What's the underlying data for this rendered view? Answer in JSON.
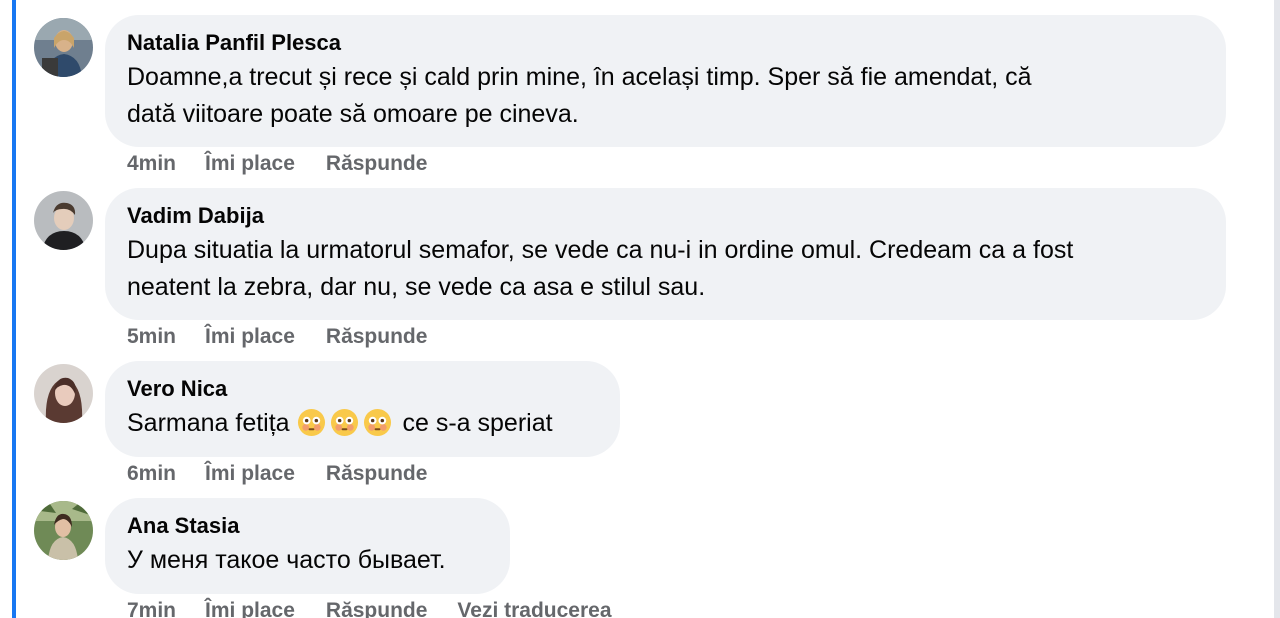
{
  "comments": [
    {
      "author": "Natalia Panfil Plesca",
      "text_lines": [
        "Doamne,a trecut și rece și cald prin mine, în același timp. Sper să fie amendat, că",
        "dată viitoare poate să omoare pe cineva."
      ],
      "time": "4min",
      "like_label": "Îmi place",
      "reply_label": "Răspunde"
    },
    {
      "author": "Vadim Dabija",
      "text_lines": [
        "Dupa situatia la urmatorul semafor, se vede ca nu-i in ordine omul. Credeam ca a fost",
        "neatent la zebra, dar nu, se vede ca asa e stilul sau."
      ],
      "time": "5min",
      "like_label": "Îmi place",
      "reply_label": "Răspunde"
    },
    {
      "author": "Vero Nica",
      "text_before_emoji": "Sarmana fetița",
      "emoji": "flushed-face-emoji",
      "emoji_count": 3,
      "text_after_emoji": "ce s-a speriat",
      "time": "6min",
      "like_label": "Îmi place",
      "reply_label": "Răspunde"
    },
    {
      "author": "Ana Stasia",
      "text_lines": [
        "У меня такое часто бывает."
      ],
      "time": "7min",
      "like_label": "Îmi place",
      "reply_label": "Răspunde",
      "translate_label": "Vezi traducerea"
    }
  ],
  "colors": {
    "bubble_bg": "#f0f2f5",
    "text": "#050505",
    "secondary_text": "#65676b",
    "accent_bar": "#1877f2"
  }
}
